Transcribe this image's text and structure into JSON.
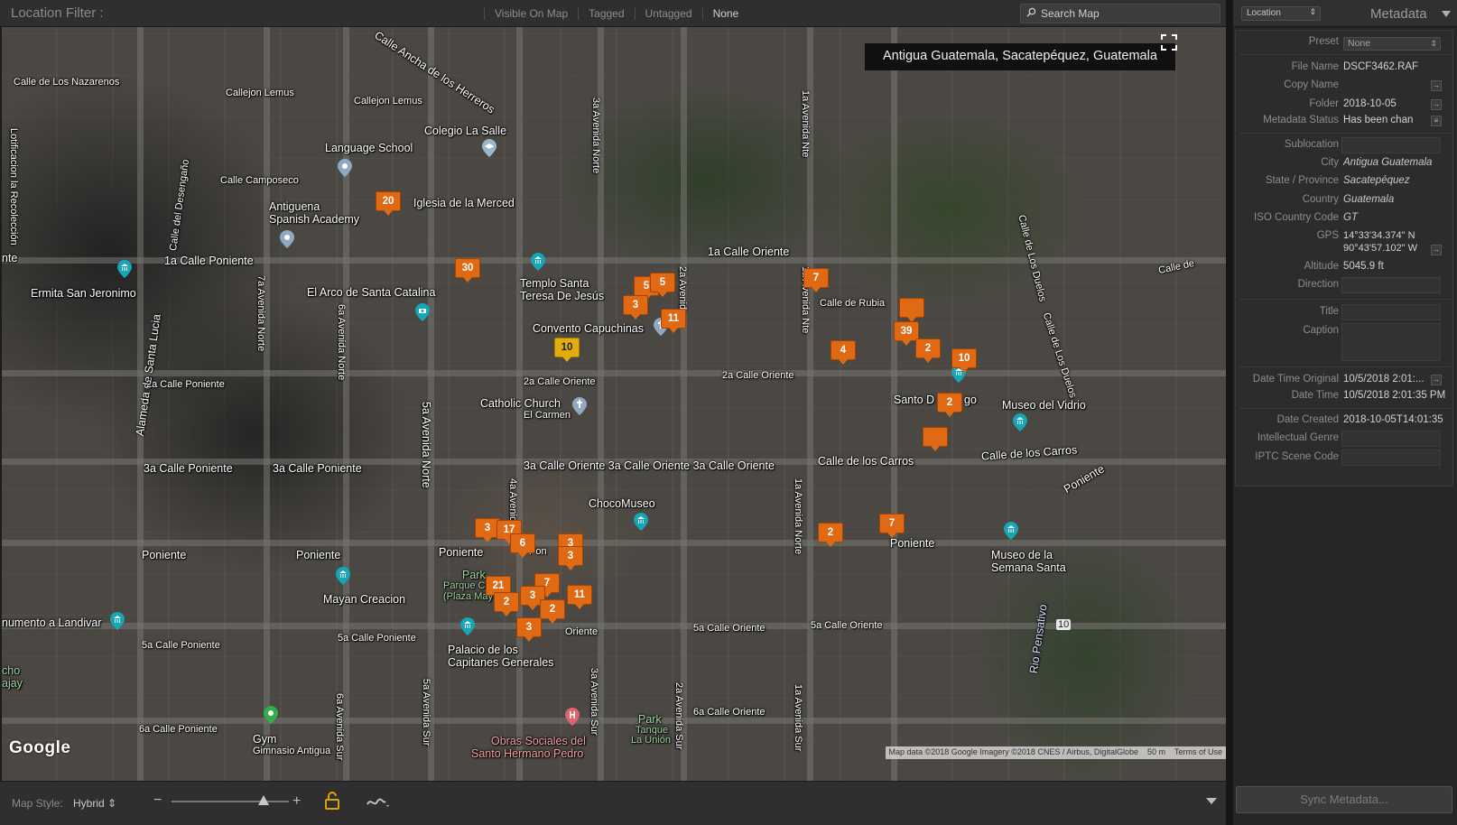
{
  "filter_bar": {
    "title": "Location Filter :",
    "options": [
      "Visible On Map",
      "Tagged",
      "Untagged",
      "None"
    ],
    "active_option": "None",
    "search_placeholder": "Search Map"
  },
  "map": {
    "location_tooltip": "Antigua Guatemala, Sacatepéquez, Guatemala",
    "google_logo": "Google",
    "attribution": "Map data ©2018 Google Imagery ©2018 CNES / Airbus, DigitalGlobe",
    "scale": "50 m",
    "terms": "Terms of Use",
    "labels": {
      "calle_nazarenos": "Calle de Los Nazarenos",
      "callejon_lemus_1": "Callejon Lemus",
      "callejon_lemus_2": "Callejon Lemus",
      "calle_ancha": "Calle Ancha de los Herreros",
      "colegio": "Colegio La Salle",
      "language_school": "Language School",
      "calle_camposeco": "Calle Camposeco",
      "antiguena": "Antiguena",
      "spanish_academy": "Spanish Academy",
      "iglesia_merced": "Iglesia de la Merced",
      "calle_desengano": "Calle del Desengaño",
      "lotificacion": "Lotificacion la Recolección",
      "nte": "nte",
      "calle1_poniente": "1a Calle Poniente",
      "ermita": "Ermita San Jeronimo",
      "arco": "El Arco de Santa Catalina",
      "templo": "Templo Santa",
      "teresa": "Teresa De Jesús",
      "convento": "Convento Capuchinas",
      "calle1_oriente": "1a Calle Oriente",
      "calle_rubia": "Calle de Rubia",
      "calle_duelos_1": "Calle de Los Duelos",
      "calle_duelos_2": "Calle de Los Duelos",
      "calle_de": "Calle de",
      "av7_norte": "7a Avenida Norte",
      "av6_norte": "6a Avenida Norte",
      "av5_norte": "5a Avenida Norte",
      "av3_norte": "3a Avenida Norte",
      "av1_norte": "1a Avenida Nte",
      "av2": "2a Avenida",
      "alameda": "Alameda de Santa Lucia",
      "calle2_poniente": "2a Calle Poniente",
      "calle2_oriente_1": "2a Calle Oriente",
      "calle2_oriente_2": "2a Calle Oriente",
      "catholic": "Catholic Church",
      "el_carmen": "El Carmen",
      "santo": "Santo D",
      "go": "go",
      "museo_vidrio": "Museo del Vidrio",
      "calle3_poniente_1": "3a Calle Poniente",
      "calle3_poniente_2": "3a Calle Poniente",
      "calle3_oriente": "3a Calle Oriente 3a Calle Oriente 3a Calle Oriente",
      "calle_carros_1": "Calle de los Carros",
      "calle_carros_2": "Calle de los Carros",
      "poniente_right": "Poniente",
      "av4": "4a Avenida",
      "chocomuseo": "ChocoMuseo",
      "poniente_1": "Poniente",
      "poniente_2": "Poniente",
      "poniente_3": "Poniente",
      "poniente_4": "Poniente",
      "pon": "Pon",
      "av1_nte_sur": "1a Avenida Norte",
      "park": "Park",
      "parque": "Parque Ce",
      "plaza": "(Plaza May",
      "museo_semana_1": "Museo de la",
      "museo_semana_2": "Semana Santa",
      "mayan": "Mayan Creacion",
      "monumento": "numento a Landivar",
      "calle5_poniente_1": "5a Calle Poniente",
      "calle5_poniente_2": "5a Calle Poniente",
      "calle5_oriente_1": "5a Calle Oriente",
      "calle5_oriente_2": "5a Calle Oriente",
      "oriente": "Oriente",
      "palacio_1": "Palacio de los",
      "palacio_2": "Capitanes Generales",
      "rio": "Rio Pensativo",
      "route_10": "10",
      "cho": "cho",
      "ajay": "ajay",
      "av6_sur": "6a Avenida Sur",
      "av5_sur": "5a Avenida Sur",
      "av3_sur": "3a Avenida Sur",
      "av2_sur": "2a Avenida Sur",
      "av1_sur": "1a Avenida Sur",
      "calle6_poniente": "6a Calle Poniente",
      "calle6_oriente": "6a Calle Oriente",
      "gym": "Gym",
      "gimnasio": "Gimnasio Antigua",
      "obras_1": "Obras Sociales del",
      "obras_2": "Santo Hermano Pedro",
      "park_tanque": "Park",
      "tanque": "Tanque",
      "la_union": "La Unión"
    },
    "markers": [
      {
        "count": "20",
        "selected": false
      },
      {
        "count": "30",
        "selected": false
      },
      {
        "count": "5",
        "selected": false
      },
      {
        "count": "5",
        "selected": false
      },
      {
        "count": "3",
        "selected": false
      },
      {
        "count": "11",
        "selected": false
      },
      {
        "count": "10",
        "selected": true
      },
      {
        "count": "7",
        "selected": false
      },
      {
        "count": "",
        "selected": false
      },
      {
        "count": "39",
        "selected": false
      },
      {
        "count": "4",
        "selected": false
      },
      {
        "count": "2",
        "selected": false
      },
      {
        "count": "10",
        "selected": false
      },
      {
        "count": "2",
        "selected": false
      },
      {
        "count": "",
        "selected": false
      },
      {
        "count": "2",
        "selected": false
      },
      {
        "count": "7",
        "selected": false
      },
      {
        "count": "3",
        "selected": false
      },
      {
        "count": "17",
        "selected": false
      },
      {
        "count": "6",
        "selected": false
      },
      {
        "count": "3",
        "selected": false
      },
      {
        "count": "3",
        "selected": false
      },
      {
        "count": "21",
        "selected": false
      },
      {
        "count": "7",
        "selected": false
      },
      {
        "count": "2",
        "selected": false
      },
      {
        "count": "3",
        "selected": false
      },
      {
        "count": "11",
        "selected": false
      },
      {
        "count": "2",
        "selected": false
      },
      {
        "count": "3",
        "selected": false
      }
    ]
  },
  "bottom_bar": {
    "map_style_label": "Map Style:",
    "map_style_value": "Hybrid"
  },
  "panel": {
    "location_dropdown": "Location",
    "title": "Metadata",
    "preset_label": "Preset",
    "preset_value": "None",
    "fields": {
      "file_name": {
        "label": "File Name",
        "value": "DSCF3462.RAF"
      },
      "copy_name": {
        "label": "Copy Name",
        "value": ""
      },
      "folder": {
        "label": "Folder",
        "value": "2018-10-05"
      },
      "metadata_status": {
        "label": "Metadata Status",
        "value": "Has been chan"
      },
      "sublocation": {
        "label": "Sublocation",
        "value": ""
      },
      "city": {
        "label": "City",
        "value": "Antigua Guatemala"
      },
      "state": {
        "label": "State / Province",
        "value": "Sacatepéquez"
      },
      "country": {
        "label": "Country",
        "value": "Guatemala"
      },
      "iso": {
        "label": "ISO Country Code",
        "value": "GT"
      },
      "gps": {
        "label": "GPS",
        "value_line1": "14°33'34.374\" N",
        "value_line2": "90°43'57.102\" W"
      },
      "altitude": {
        "label": "Altitude",
        "value": "5045.9 ft"
      },
      "direction": {
        "label": "Direction",
        "value": ""
      },
      "title": {
        "label": "Title",
        "value": ""
      },
      "caption": {
        "label": "Caption",
        "value": ""
      },
      "dto": {
        "label": "Date Time Original",
        "value": "10/5/2018 2:01:..."
      },
      "dt": {
        "label": "Date Time",
        "value": "10/5/2018 2:01:35 PM"
      },
      "date_created": {
        "label": "Date Created",
        "value": "2018-10-05T14:01:35"
      },
      "genre": {
        "label": "Intellectual Genre",
        "value": ""
      },
      "iptc": {
        "label": "IPTC Scene Code",
        "value": ""
      }
    },
    "sync_button": "Sync Metadata..."
  }
}
